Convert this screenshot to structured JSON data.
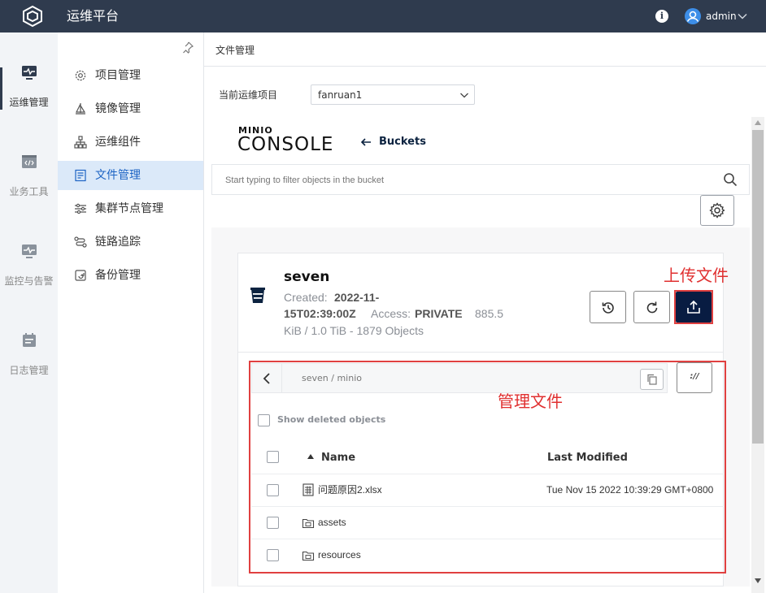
{
  "app": {
    "title": "运维平台",
    "user": "admin"
  },
  "rail": [
    {
      "label": "运维管理",
      "icon": "monitor-pulse-icon"
    },
    {
      "label": "业务工具",
      "icon": "code-window-icon"
    },
    {
      "label": "监控与告警",
      "icon": "monitor-alert-icon"
    },
    {
      "label": "日志管理",
      "icon": "calendar-log-icon"
    }
  ],
  "subnav": [
    {
      "label": "项目管理",
      "icon": "gear-icon"
    },
    {
      "label": "镜像管理",
      "icon": "sail-icon"
    },
    {
      "label": "运维组件",
      "icon": "hierarchy-icon"
    },
    {
      "label": "文件管理",
      "icon": "document-icon"
    },
    {
      "label": "集群节点管理",
      "icon": "sliders-icon"
    },
    {
      "label": "链路追踪",
      "icon": "trace-icon"
    },
    {
      "label": "备份管理",
      "icon": "backup-icon"
    }
  ],
  "page": {
    "title": "文件管理"
  },
  "project": {
    "label": "当前运维项目",
    "value": "fanruan1"
  },
  "console": {
    "brand": "MINIO",
    "name": "CONSOLE",
    "buckets_link": "Buckets",
    "filter_placeholder": "Start typing to filter objects in the bucket"
  },
  "bucket": {
    "name": "seven",
    "created_label": "Created:",
    "created_value_1": "2022-11-",
    "created_value_2": "15T02:39:00Z",
    "access_label": "Access:",
    "access_value": "PRIVATE",
    "size_1": "885.5",
    "size_2": "KiB / 1.0 TiB - 1879 Objects"
  },
  "annotations": {
    "upload": "上传文件",
    "manage": "管理文件"
  },
  "browser": {
    "path": "seven  /  minio",
    "rewind_label": "://",
    "show_deleted": "Show deleted objects",
    "columns": {
      "name": "Name",
      "modified": "Last Modified"
    },
    "rows": [
      {
        "name": "问题原因2.xlsx",
        "type": "spreadsheet",
        "modified": "Tue Nov 15 2022 10:39:29 GMT+0800"
      },
      {
        "name": "assets",
        "type": "folder",
        "modified": ""
      },
      {
        "name": "resources",
        "type": "folder",
        "modified": ""
      }
    ]
  },
  "colors": {
    "topbar": "#2f3b4e",
    "accent": "#1d64c4",
    "annotation_red": "#e03030",
    "upload_button": "#081c42"
  }
}
